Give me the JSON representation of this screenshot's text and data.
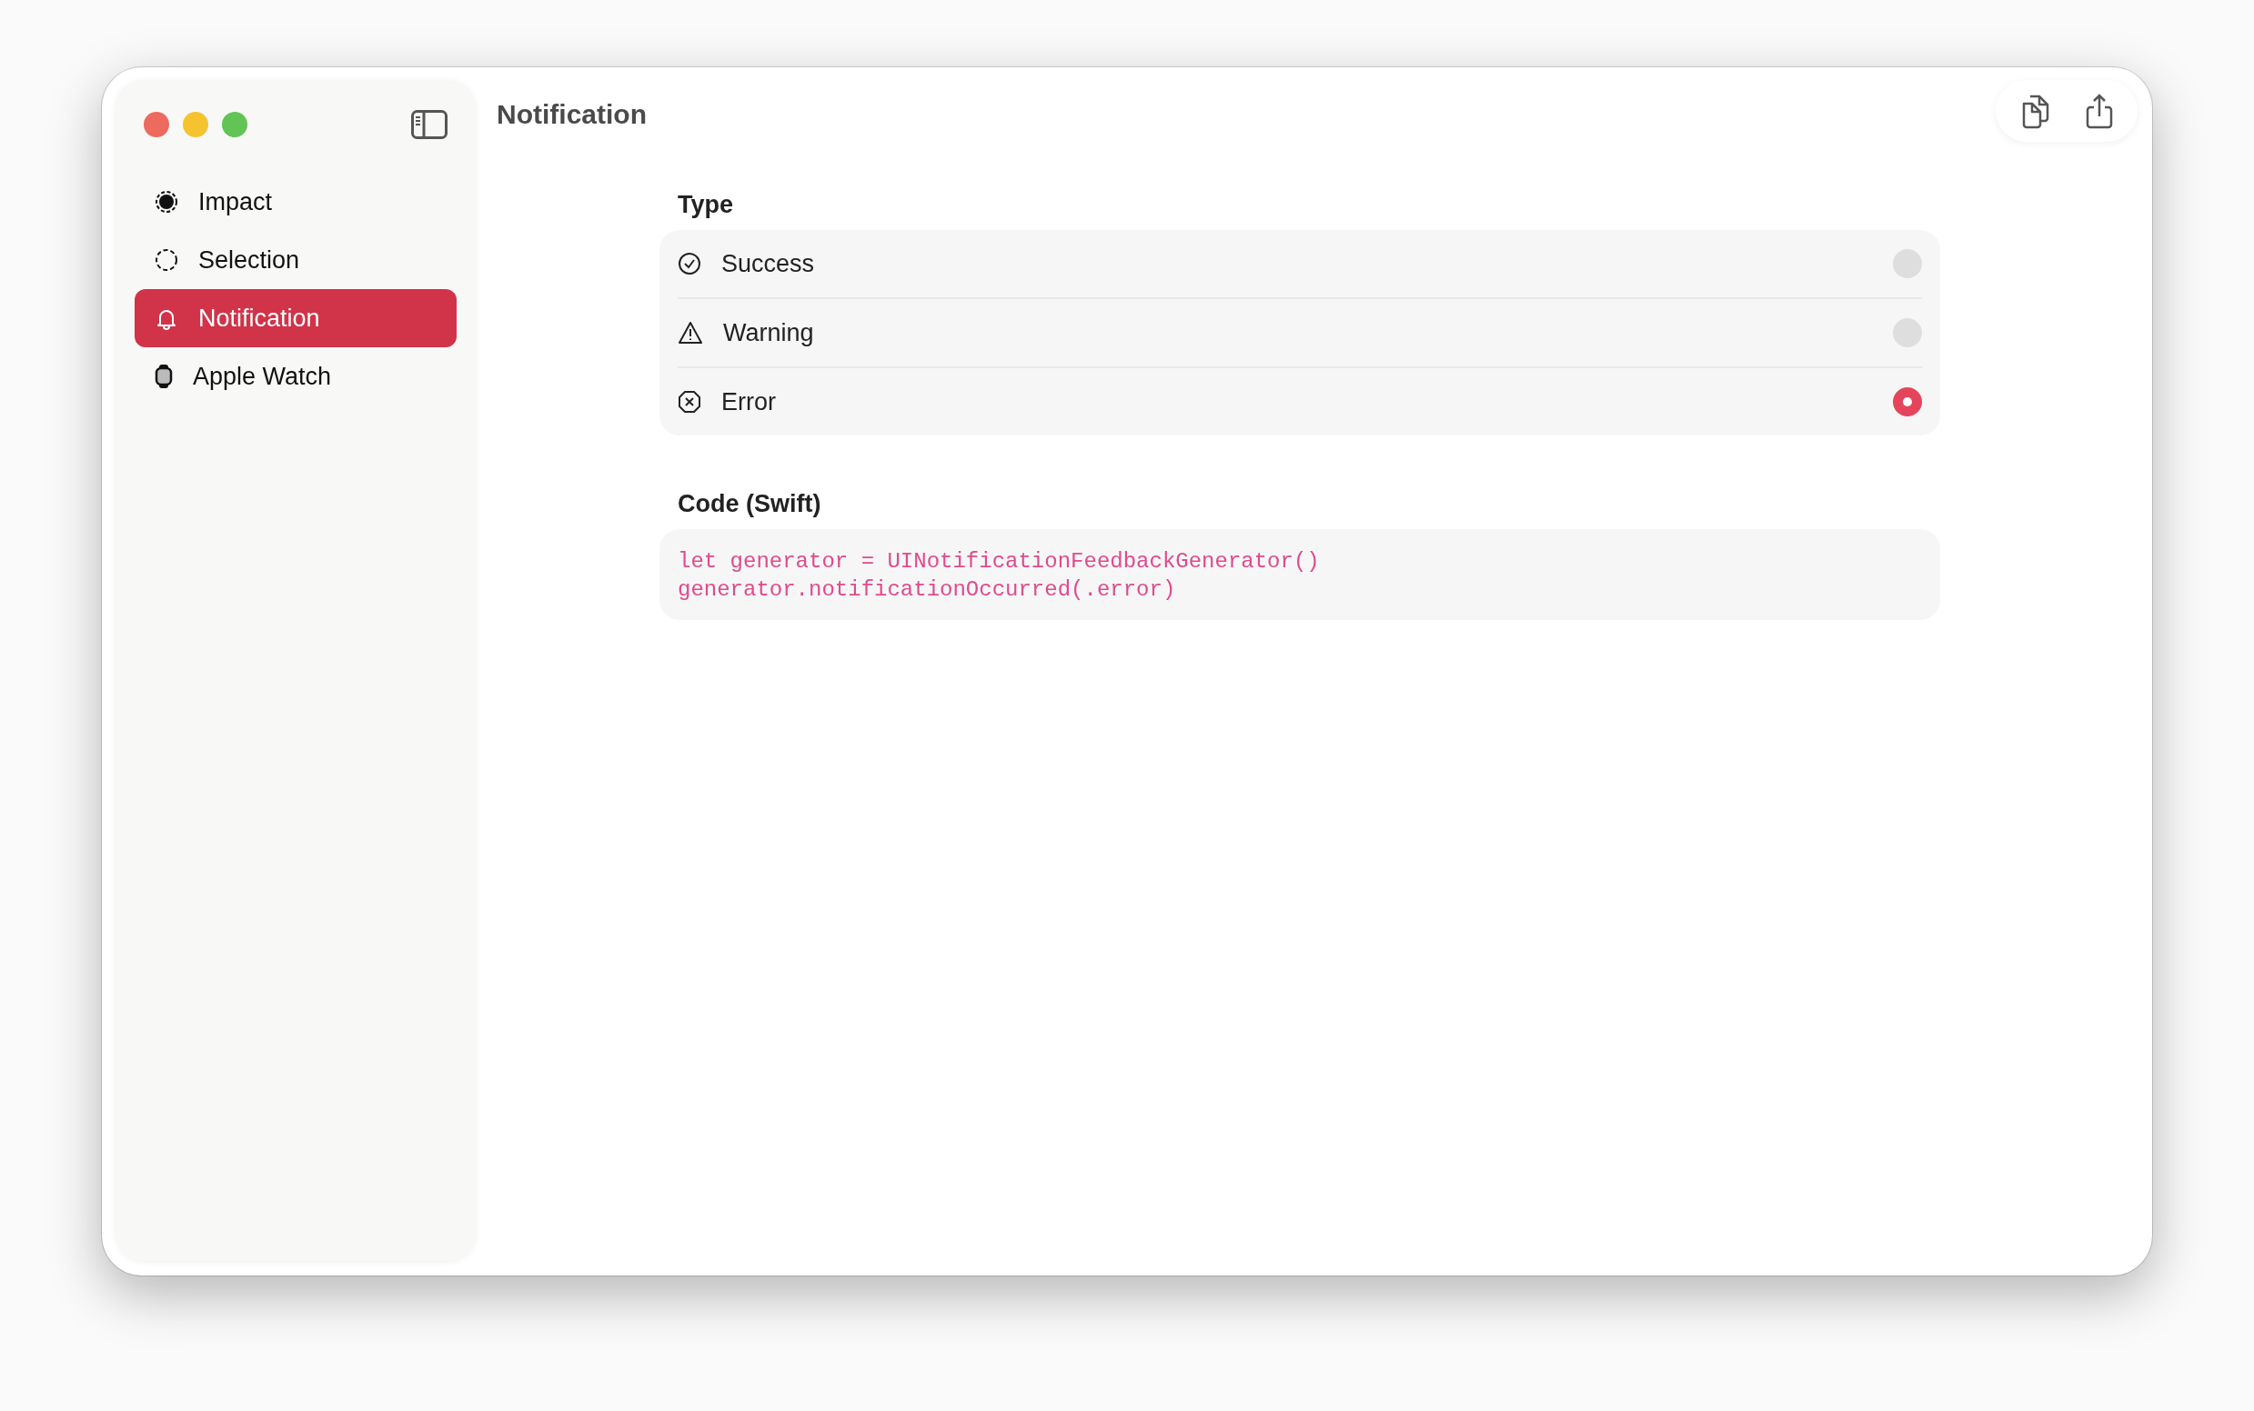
{
  "window": {
    "title": "Notification"
  },
  "sidebar": {
    "items": [
      {
        "label": "Impact",
        "kind": "impact",
        "selected": false
      },
      {
        "label": "Selection",
        "kind": "selection",
        "selected": false
      },
      {
        "label": "Notification",
        "kind": "bell",
        "selected": true
      },
      {
        "label": "Apple Watch",
        "kind": "watch",
        "selected": false
      }
    ]
  },
  "type_section": {
    "heading": "Type",
    "options": [
      {
        "label": "Success",
        "kind": "success",
        "selected": false
      },
      {
        "label": "Warning",
        "kind": "warning",
        "selected": false
      },
      {
        "label": "Error",
        "kind": "error",
        "selected": true
      }
    ]
  },
  "code_section": {
    "heading": "Code (Swift)",
    "lines": [
      "let generator = UINotificationFeedbackGenerator()",
      "generator.notificationOccurred(.error)"
    ]
  }
}
